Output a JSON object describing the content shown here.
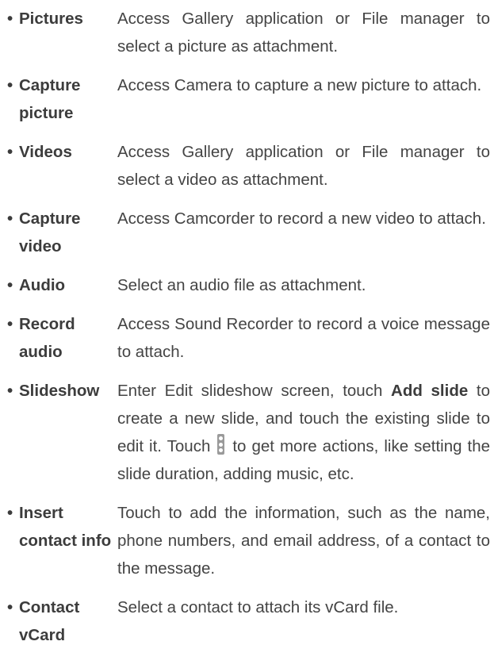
{
  "items": [
    {
      "term": [
        "Pictures"
      ],
      "desc": "Access Gallery application or File manager to select a picture as attachment."
    },
    {
      "term": [
        "Capture",
        "picture"
      ],
      "desc": "Access Camera to capture a new picture to attach."
    },
    {
      "term": [
        "Videos"
      ],
      "desc": "Access Gallery application or File manager to select a video as attachment."
    },
    {
      "term": [
        "Capture",
        "video"
      ],
      "desc": "Access Camcorder to record a new video to attach."
    },
    {
      "term": [
        "Audio"
      ],
      "desc": "Select an audio file as attachment."
    },
    {
      "term": [
        "Record",
        "audio"
      ],
      "desc": "Access Sound Recorder to record a voice message to attach."
    },
    {
      "term": [
        "Slideshow"
      ],
      "desc_parts": {
        "before": "Enter Edit slideshow screen, touch ",
        "bold": "Add slide",
        "middle": " to create a new slide, and touch the existing slide to edit it. Touch ",
        "icon": "more-vertical-icon",
        "after": " to get more actions, like setting the slide duration, adding music, etc."
      }
    },
    {
      "term": [
        "Insert",
        "contact info"
      ],
      "desc": "Touch to add the information, such as the name, phone numbers, and email address, of a contact to the message."
    },
    {
      "term": [
        "Contact",
        "vCard"
      ],
      "desc": "Select a contact to attach its vCard file."
    }
  ],
  "bullet": "•"
}
